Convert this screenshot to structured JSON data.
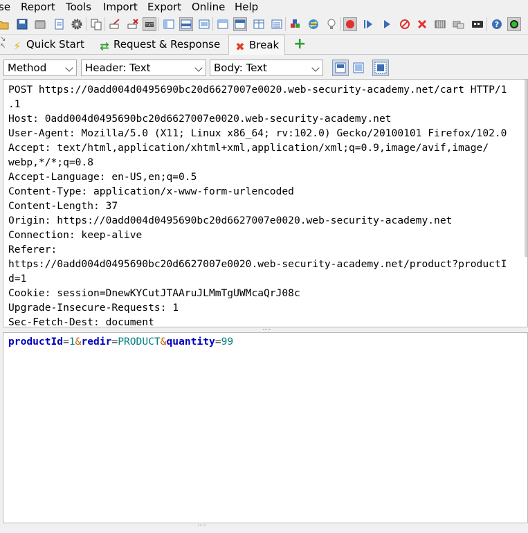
{
  "menu": [
    "se",
    "Report",
    "Tools",
    "Import",
    "Export",
    "Online",
    "Help"
  ],
  "toolbar_icons": [
    "open-icon",
    "save-icon",
    "archive-icon",
    "document-icon",
    "settings-icon",
    "copy-icon",
    "edit-icon",
    "delete-icon",
    "text-icon",
    "layout-1-icon",
    "layout-2-icon",
    "layout-3-icon",
    "layout-4-icon",
    "layout-5-icon",
    "layout-6-icon",
    "layout-7-icon",
    "cube-icon",
    "swap-icon",
    "lightbulb-icon",
    "record-icon",
    "resume-all-icon",
    "resume-icon",
    "stop-icon",
    "cancel-icon",
    "grid-icon",
    "keyboard-icon",
    "terminal-icon",
    "help-icon",
    "status-icon"
  ],
  "tabs": [
    {
      "label": "Quick Start",
      "icon": "lightning-icon"
    },
    {
      "label": "Request & Response",
      "icon": "exchange-icon"
    },
    {
      "label": "Break",
      "icon": "close-icon"
    }
  ],
  "add_tab_icon": "plus-icon",
  "controls": {
    "method": "Method",
    "header_mode": "Header: Text",
    "body_mode": "Body: Text"
  },
  "request_headers": [
    "POST https://0add004d0495690bc20d6627007e0020.web-security-academy.net/cart HTTP/1",
    ".1",
    "Host: 0add004d0495690bc20d6627007e0020.web-security-academy.net",
    "User-Agent: Mozilla/5.0 (X11; Linux x86_64; rv:102.0) Gecko/20100101 Firefox/102.0",
    "Accept: text/html,application/xhtml+xml,application/xml;q=0.9,image/avif,image/",
    "webp,*/*;q=0.8",
    "Accept-Language: en-US,en;q=0.5",
    "Content-Type: application/x-www-form-urlencoded",
    "Content-Length: 37",
    "Origin: https://0add004d0495690bc20d6627007e0020.web-security-academy.net",
    "Connection: keep-alive",
    "Referer:",
    "https://0add004d0495690bc20d6627007e0020.web-security-academy.net/product?productI",
    "d=1",
    "Cookie: session=DnewKYCutJTAAruJLMmTgUWMcaQrJ08c",
    "Upgrade-Insecure-Requests: 1",
    "Sec-Fetch-Dest: document"
  ],
  "body": {
    "p1_key": "productId",
    "eq1": "=",
    "p1_val": "1",
    "amp1": "&",
    "p2_key": "redir",
    "eq2": "=",
    "p2_val": "PRODUCT",
    "amp2": "&",
    "p3_key": "quantity",
    "eq3": "=",
    "p3_val": "99"
  },
  "colors": {
    "param_key": "#0000c0",
    "param_value": "#008080",
    "ampersand": "#c06000",
    "break_tab_icon": "#e04020",
    "add_icon": "#2ea02e"
  }
}
